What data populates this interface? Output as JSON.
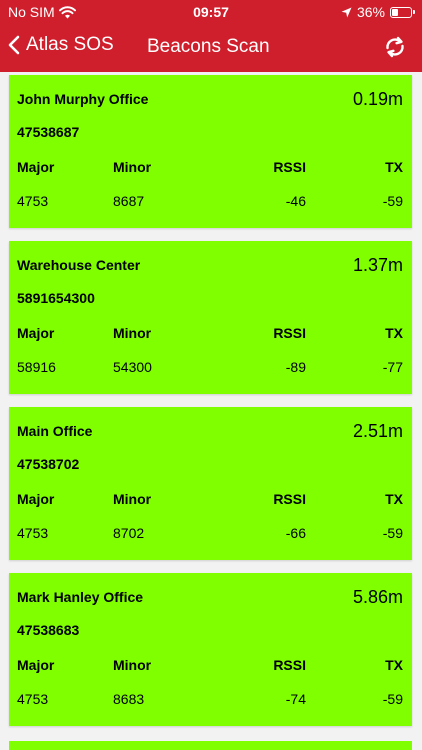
{
  "status": {
    "carrier": "No SIM",
    "time": "09:57",
    "battery": "36%",
    "battery_level": 0.36
  },
  "nav": {
    "back_label": "Atlas SOS",
    "title": "Beacons Scan"
  },
  "colors": {
    "header": "#cf1f2d",
    "card": "#7fff00",
    "background": "#f2f2f2"
  },
  "columns": {
    "major": "Major",
    "minor": "Minor",
    "rssi": "RSSI",
    "tx": "TX"
  },
  "beacons": [
    {
      "name": "John Murphy Office",
      "distance": "0.19m",
      "id": "47538687",
      "major": "4753",
      "minor": "8687",
      "rssi": "-46",
      "tx": "-59"
    },
    {
      "name": "Warehouse Center",
      "distance": "1.37m",
      "id": "5891654300",
      "major": "58916",
      "minor": "54300",
      "rssi": "-89",
      "tx": "-77"
    },
    {
      "name": "Main Office",
      "distance": "2.51m",
      "id": "47538702",
      "major": "4753",
      "minor": "8702",
      "rssi": "-66",
      "tx": "-59"
    },
    {
      "name": "Mark Hanley Office",
      "distance": "5.86m",
      "id": "47538683",
      "major": "4753",
      "minor": "8683",
      "rssi": "-74",
      "tx": "-59"
    }
  ]
}
